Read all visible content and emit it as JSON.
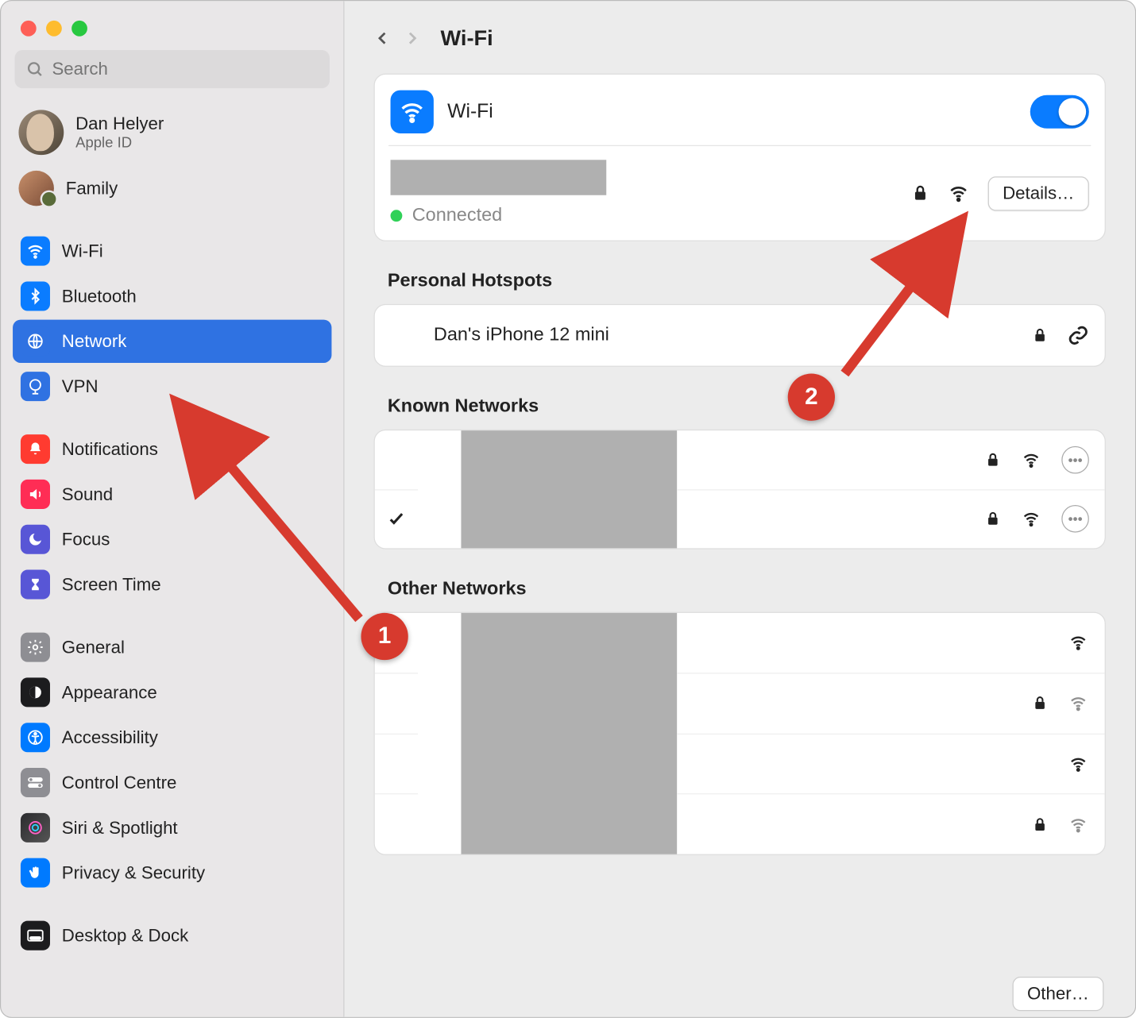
{
  "window": {
    "title": "Wi-Fi"
  },
  "search": {
    "placeholder": "Search"
  },
  "account": {
    "name": "Dan Helyer",
    "sub": "Apple ID",
    "family": "Family"
  },
  "sidebar": {
    "items": [
      {
        "label": "Wi-Fi"
      },
      {
        "label": "Bluetooth"
      },
      {
        "label": "Network"
      },
      {
        "label": "VPN"
      },
      {
        "label": "Notifications"
      },
      {
        "label": "Sound"
      },
      {
        "label": "Focus"
      },
      {
        "label": "Screen Time"
      },
      {
        "label": "General"
      },
      {
        "label": "Appearance"
      },
      {
        "label": "Accessibility"
      },
      {
        "label": "Control Centre"
      },
      {
        "label": "Siri & Spotlight"
      },
      {
        "label": "Privacy & Security"
      },
      {
        "label": "Desktop & Dock"
      }
    ]
  },
  "wifi": {
    "label": "Wi-Fi",
    "status": "Connected",
    "details_btn": "Details…"
  },
  "sections": {
    "personal": "Personal Hotspots",
    "known": "Known Networks",
    "other": "Other Networks"
  },
  "hotspot": {
    "name": "Dan's iPhone 12 mini"
  },
  "buttons": {
    "other": "Other…"
  },
  "annotations": {
    "badge1": "1",
    "badge2": "2"
  }
}
